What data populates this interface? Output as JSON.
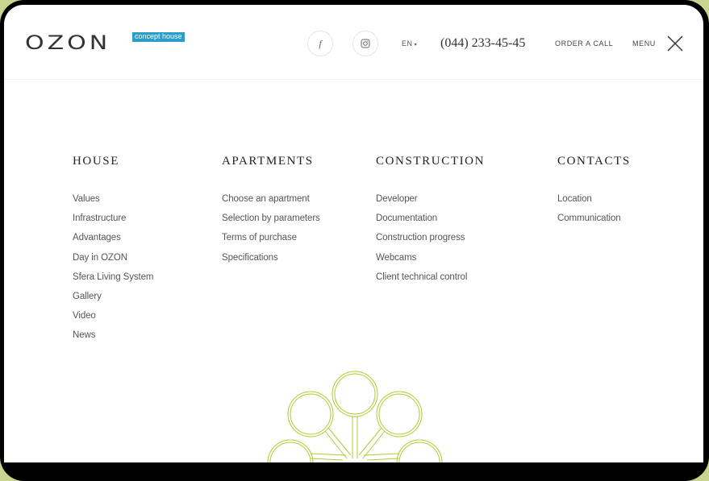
{
  "header": {
    "logo": "OZON",
    "badge": "concept house",
    "social": [
      {
        "name": "facebook-icon",
        "glyph": "f"
      },
      {
        "name": "instagram-icon",
        "glyph": "◎"
      }
    ],
    "language": "EN",
    "phone": "(044) 233-45-45",
    "order_call": "ORDER A CALL",
    "menu_label": "MENU"
  },
  "menu": {
    "columns": [
      {
        "title": "HOUSE",
        "items": [
          "Values",
          "Infrastructure",
          "Advantages",
          "Day in OZON",
          "Sfera Living System",
          "Gallery",
          "Video",
          "News"
        ]
      },
      {
        "title": "APARTMENTS",
        "items": [
          "Choose an apartment",
          "Selection by parameters",
          "Terms of purchase",
          "Specifications"
        ]
      },
      {
        "title": "CONSTRUCTION",
        "items": [
          "Developer",
          "Documentation",
          "Construction progress",
          "Webcams",
          "Client technical control"
        ]
      },
      {
        "title": "CONTACTS",
        "items": [
          "Location",
          "Communication"
        ]
      }
    ]
  },
  "colors": {
    "accent_badge": "#2a9dc8",
    "emblem": "#b5c832",
    "bezel": "#c9d48f"
  }
}
